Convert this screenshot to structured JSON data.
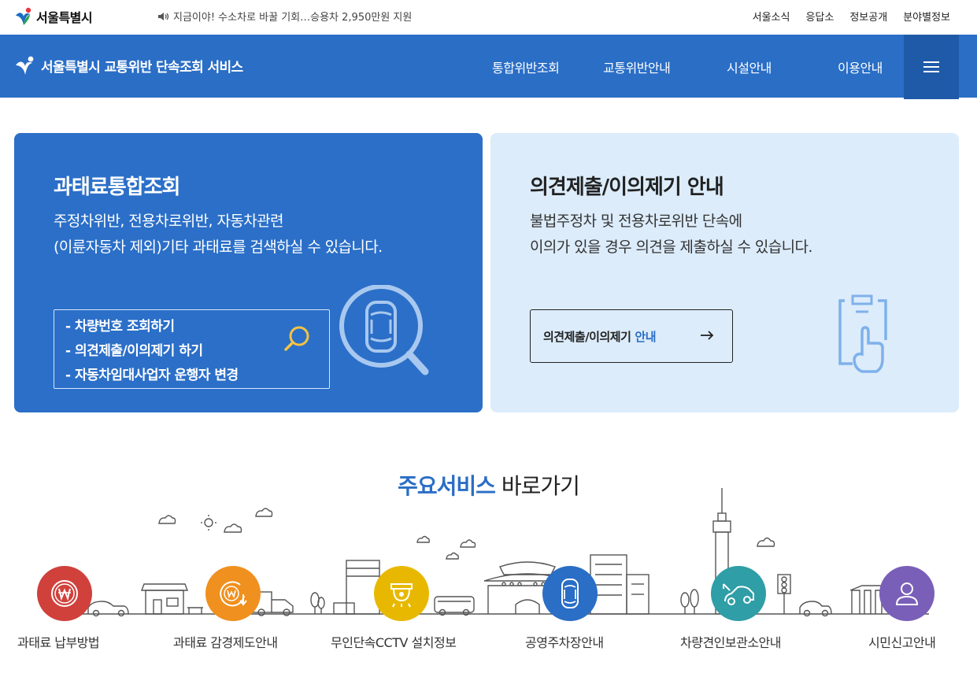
{
  "topbar": {
    "logo_text": "서울특별시",
    "notice": "지금이야! 수소차로 바꿀 기회…승용차 2,950만원 지원",
    "links": [
      "서울소식",
      "응답소",
      "정보공개",
      "분야별정보"
    ]
  },
  "header": {
    "title": "서울특별시 교통위반 단속조회 서비스",
    "nav": [
      "통합위반조회",
      "교통위반안내",
      "시설안내",
      "이용안내"
    ]
  },
  "card_left": {
    "title": "과태료통합조회",
    "desc_line1": "주정차위반, 전용차로위반, 자동차관련",
    "desc_line2": "(이륜자동차 제외)기타 과태료를 검색하실 수 있습니다.",
    "links": [
      "- 차량번호 조회하기",
      "- 의견제출/이의제기 하기",
      "- 자동차임대사업자 운행자 변경"
    ]
  },
  "card_right": {
    "title": "의견제출/이의제기 안내",
    "desc_line1": "불법주정차 및 전용차로위반 단속에",
    "desc_line2": "이의가 있을 경우 의견을 제출하실 수 있습니다.",
    "button_main": "의견제출/이의제기",
    "button_accent": "안내"
  },
  "section": {
    "title_highlight": "주요서비스",
    "title_rest": " 바로가기"
  },
  "services": [
    {
      "label": "과태료 납부방법",
      "color": "#d0413c",
      "icon": "won-coin-icon"
    },
    {
      "label": "과태료 감경제도안내",
      "color": "#f0901e",
      "icon": "won-discount-icon"
    },
    {
      "label": "무인단속CCTV 설치정보",
      "color": "#e8b800",
      "icon": "cctv-icon"
    },
    {
      "label": "공영주차장안내",
      "color": "#2a6ec6",
      "icon": "car-top-icon"
    },
    {
      "label": "차량견인보관소안내",
      "color": "#2f9ea6",
      "icon": "tow-truck-icon"
    },
    {
      "label": "시민신고안내",
      "color": "#7a5fb8",
      "icon": "person-icon"
    }
  ],
  "colors": {
    "primary": "#2a6ec6",
    "menu_dark": "#1f5aa8",
    "card_light": "#dcecfb"
  }
}
